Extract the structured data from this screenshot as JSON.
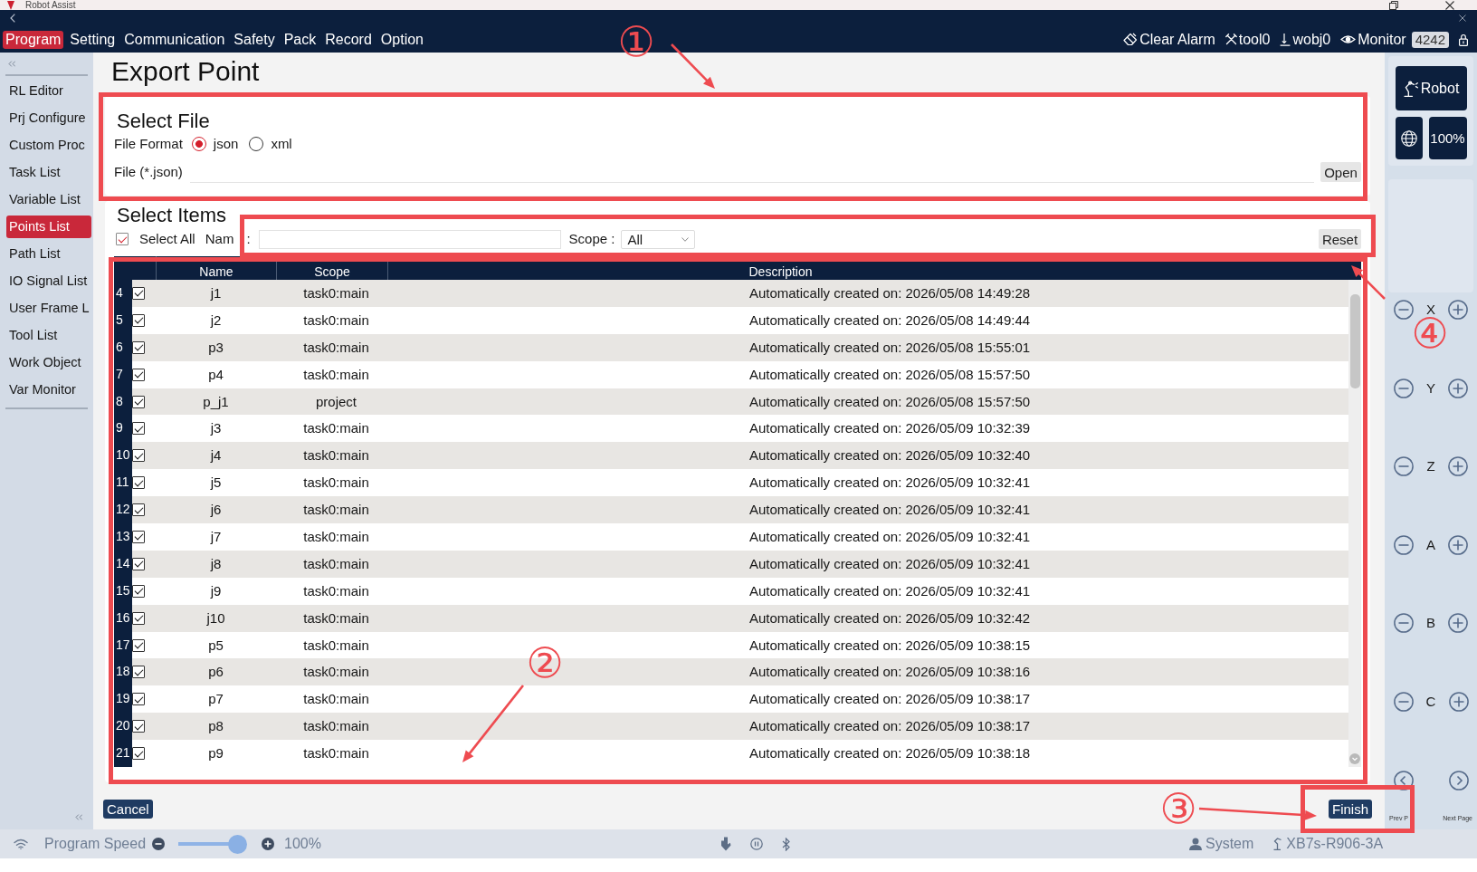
{
  "window": {
    "title": "Robot Assist"
  },
  "menu_bar": {
    "items": [
      {
        "label": "Program",
        "selected": true
      },
      {
        "label": "Setting",
        "selected": false
      },
      {
        "label": "Communication",
        "selected": false
      },
      {
        "label": "Safety",
        "selected": false
      },
      {
        "label": "Pack",
        "selected": false
      },
      {
        "label": "Record",
        "selected": false
      },
      {
        "label": "Option",
        "selected": false
      }
    ]
  },
  "status_tools": {
    "clear_alarm": "Clear Alarm",
    "tool": "tool0",
    "work_object": "wobj0",
    "monitor": "Monitor",
    "monitor_badge": "4242"
  },
  "sidebar": {
    "items": [
      {
        "label": "RL Editor",
        "selected": false
      },
      {
        "label": "Prj Configure",
        "selected": false
      },
      {
        "label": "Custom Proc",
        "selected": false
      },
      {
        "label": "Task List",
        "selected": false
      },
      {
        "label": "Variable List",
        "selected": false
      },
      {
        "label": "Points List",
        "selected": true
      },
      {
        "label": "Path List",
        "selected": false
      },
      {
        "label": "IO Signal List",
        "selected": false
      },
      {
        "label": "User Frame L",
        "selected": false
      },
      {
        "label": "Tool List",
        "selected": false
      },
      {
        "label": "Work Object",
        "selected": false
      },
      {
        "label": "Var Monitor",
        "selected": false
      }
    ]
  },
  "page": {
    "title": "Export Point"
  },
  "select_file": {
    "heading": "Select File",
    "format_label": "File Format",
    "formats": [
      {
        "label": "json",
        "selected": true
      },
      {
        "label": "xml",
        "selected": false
      }
    ],
    "file_label": "File (*.json)",
    "open_button": "Open"
  },
  "select_items": {
    "heading": "Select Items",
    "select_all": {
      "label": "Select All",
      "checked": true
    },
    "name_label": "Nam",
    "name_colon": ":",
    "scope_label": "Scope :",
    "scope_value": "All",
    "reset_button": "Reset",
    "table": {
      "columns": [
        "Name",
        "Scope",
        "Description"
      ],
      "rows": [
        {
          "number": "4",
          "checked": true,
          "name": "j1",
          "scope": "task0:main",
          "description": "Automatically created on: 2026/05/08 14:49:28"
        },
        {
          "number": "5",
          "checked": true,
          "name": "j2",
          "scope": "task0:main",
          "description": "Automatically created on: 2026/05/08 14:49:44"
        },
        {
          "number": "6",
          "checked": true,
          "name": "p3",
          "scope": "task0:main",
          "description": "Automatically created on: 2026/05/08 15:55:01"
        },
        {
          "number": "7",
          "checked": true,
          "name": "p4",
          "scope": "task0:main",
          "description": "Automatically created on: 2026/05/08 15:57:50"
        },
        {
          "number": "8",
          "checked": true,
          "name": "p_j1",
          "scope": "project",
          "description": "Automatically created on: 2026/05/08 15:57:50"
        },
        {
          "number": "9",
          "checked": true,
          "name": "j3",
          "scope": "task0:main",
          "description": "Automatically created on: 2026/05/09 10:32:39"
        },
        {
          "number": "10",
          "checked": true,
          "name": "j4",
          "scope": "task0:main",
          "description": "Automatically created on: 2026/05/09 10:32:40"
        },
        {
          "number": "11",
          "checked": true,
          "name": "j5",
          "scope": "task0:main",
          "description": "Automatically created on: 2026/05/09 10:32:41"
        },
        {
          "number": "12",
          "checked": true,
          "name": "j6",
          "scope": "task0:main",
          "description": "Automatically created on: 2026/05/09 10:32:41"
        },
        {
          "number": "13",
          "checked": true,
          "name": "j7",
          "scope": "task0:main",
          "description": "Automatically created on: 2026/05/09 10:32:41"
        },
        {
          "number": "14",
          "checked": true,
          "name": "j8",
          "scope": "task0:main",
          "description": "Automatically created on: 2026/05/09 10:32:41"
        },
        {
          "number": "15",
          "checked": true,
          "name": "j9",
          "scope": "task0:main",
          "description": "Automatically created on: 2026/05/09 10:32:41"
        },
        {
          "number": "16",
          "checked": true,
          "name": "j10",
          "scope": "task0:main",
          "description": "Automatically created on: 2026/05/09 10:32:42"
        },
        {
          "number": "17",
          "checked": true,
          "name": "p5",
          "scope": "task0:main",
          "description": "Automatically created on: 2026/05/09 10:38:15"
        },
        {
          "number": "18",
          "checked": true,
          "name": "p6",
          "scope": "task0:main",
          "description": "Automatically created on: 2026/05/09 10:38:16"
        },
        {
          "number": "19",
          "checked": true,
          "name": "p7",
          "scope": "task0:main",
          "description": "Automatically created on: 2026/05/09 10:38:17"
        },
        {
          "number": "20",
          "checked": true,
          "name": "p8",
          "scope": "task0:main",
          "description": "Automatically created on: 2026/05/09 10:38:17"
        },
        {
          "number": "21",
          "checked": true,
          "name": "p9",
          "scope": "task0:main",
          "description": "Automatically created on: 2026/05/09 10:38:18"
        }
      ]
    }
  },
  "footer": {
    "cancel_button": "Cancel",
    "finish_button": "Finish"
  },
  "right_panel": {
    "robot_button": "Robot",
    "speed_button": "100%",
    "jog_axes": [
      "X",
      "Y",
      "Z",
      "A",
      "B",
      "C"
    ],
    "prev_page": "Prev P",
    "next_page": "Next Page"
  },
  "status_bar": {
    "speed_label": "Program Speed",
    "speed": {
      "level": 1
    },
    "speed_reading": "100%",
    "user": "System",
    "device": "XB7s-R906-3A"
  },
  "annotations": [
    {
      "number": "①"
    },
    {
      "number": "②"
    },
    {
      "number": "③"
    },
    {
      "number": "④"
    }
  ]
}
